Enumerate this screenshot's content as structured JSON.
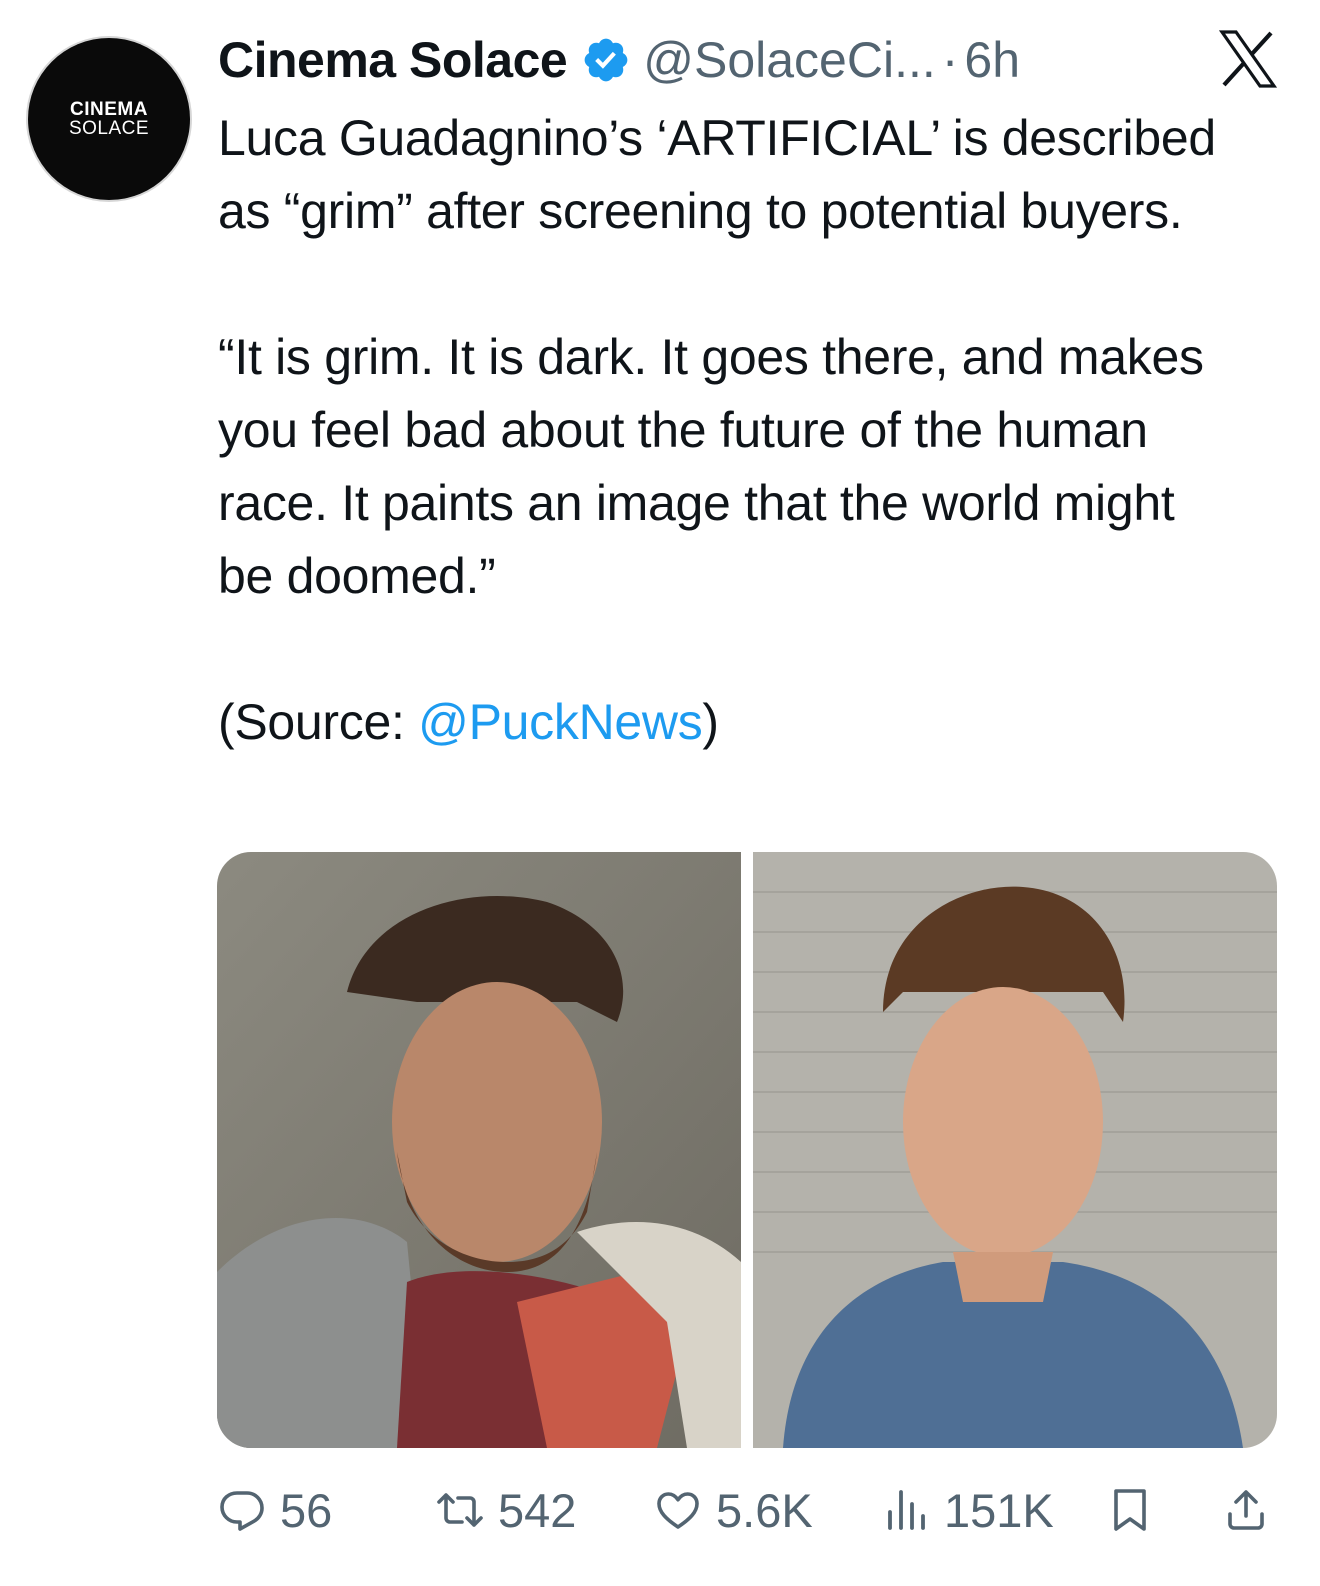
{
  "author": {
    "avatar_line1": "CINEMA",
    "avatar_line2": "SOLACE",
    "name": "Cinema Solace",
    "handle": "@SolaceCi...",
    "separator": "·",
    "time": "6h",
    "verified": true
  },
  "tweet": {
    "paragraph1": "Luca Guadagnino’s ‘ARTIFICIAL’ is described as “grim” after screening to potential buyers.",
    "paragraph2": "“It is grim. It is dark. It goes there, and makes you feel bad about the future of the human race. It paints an image that the world might be doomed.”",
    "source_prefix": "(Source: ",
    "source_link": "@PuckNews",
    "source_suffix": ")"
  },
  "media": {
    "count": 2
  },
  "actions": {
    "replies": "56",
    "reposts": "542",
    "likes": "5.6K",
    "views": "151K"
  },
  "colors": {
    "link": "#1d9bf0",
    "verified": "#1d9bf0",
    "muted": "#536471",
    "text": "#0f1419"
  },
  "icons": [
    "verified-badge-icon",
    "x-logo-icon",
    "reply-icon",
    "repost-icon",
    "like-icon",
    "views-icon",
    "bookmark-icon",
    "share-icon"
  ]
}
